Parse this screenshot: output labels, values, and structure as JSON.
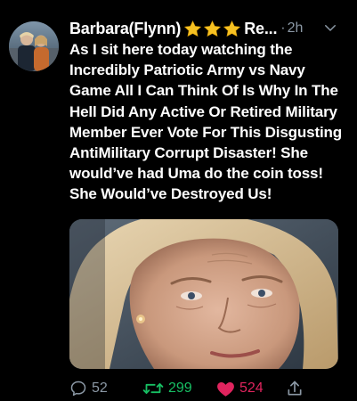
{
  "tweet": {
    "author_name": "Barbara(Flynn)",
    "author_suffix": "Re...",
    "separator": "·",
    "time": "2h",
    "text": "As I sit here today watching the Incredibly Patriotic Army vs Navy Game All I Can Think Of Is Why In The Hell Did Any Active Or Retired Military Member Ever Vote For This Disgusting AntiMilitary Corrupt Disaster! She would’ve had Uma do the coin toss! She Would’ve Destroyed Us!",
    "star_count": 3,
    "star_icon": "star-icon",
    "star_color": "#f6c122"
  },
  "actions": {
    "reply_count": "52",
    "retweet_count": "299",
    "like_count": "524"
  },
  "colors": {
    "background": "#000000",
    "text": "#ffffff",
    "muted": "#8b98a5",
    "retweet": "#17bf63",
    "like": "#e0245e"
  },
  "icons": {
    "reply": "reply-icon",
    "retweet": "retweet-icon",
    "like": "heart-icon",
    "share": "share-icon",
    "more": "chevron-down-icon"
  }
}
